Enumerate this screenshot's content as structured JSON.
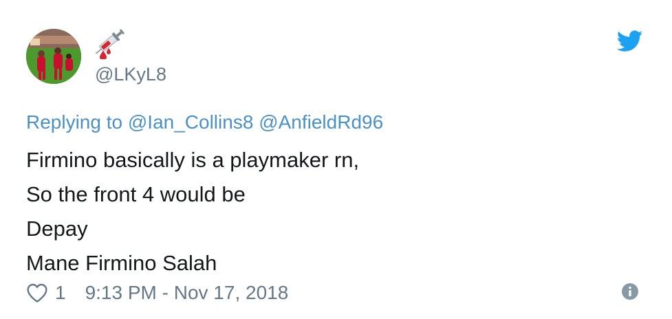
{
  "user": {
    "display_name_icons": [
      "syringe-emoji",
      "blood-drop-emoji"
    ],
    "handle": "@LKyL8"
  },
  "reply": {
    "prefix": "Replying to",
    "mentions": [
      "@Ian_Collins8",
      "@AnfieldRd96"
    ]
  },
  "tweet": {
    "lines": [
      "Firmino basically is a playmaker rn,",
      "So the front 4 would be",
      "Depay",
      "Mane Firmino Salah"
    ]
  },
  "footer": {
    "like_count": "1",
    "timestamp": "9:13 PM - Nov 17, 2018"
  },
  "colors": {
    "link": "#4a90c8",
    "twitter_blue": "#1da1f2",
    "muted": "#657786"
  },
  "icons": {
    "brand": "twitter-bird-icon",
    "like": "heart-icon",
    "info": "info-icon"
  }
}
